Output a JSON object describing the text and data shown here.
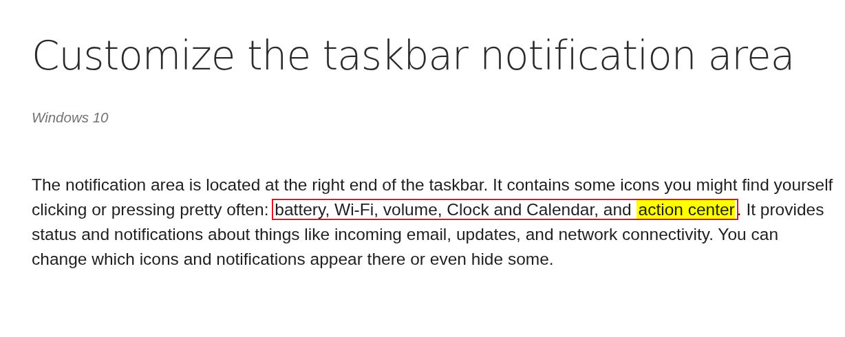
{
  "title": "Customize the taskbar notification area",
  "applies_to": "Windows 10",
  "intro": {
    "before": "The notification area is located at the right end of the taskbar. It contains some icons you might find yourself clicking or pressing pretty often: ",
    "boxed": "battery, Wi-Fi, volume, Clock and Calendar, and ",
    "highlighted": "action center",
    "after": ". It provides status and notifications about things like incoming email, updates, and network connectivity. You can change which icons and notifications appear there or even hide some."
  }
}
